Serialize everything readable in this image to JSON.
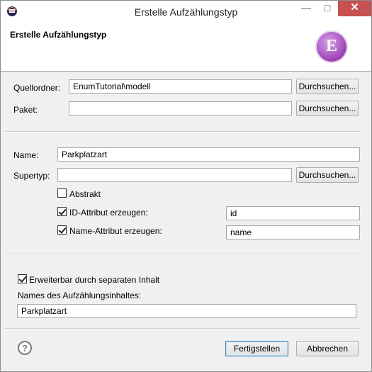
{
  "window": {
    "title": "Erstelle Aufzählungstyp"
  },
  "header": {
    "title": "Erstelle Aufzählungstyp",
    "icon": "enum-e-icon"
  },
  "source_folder": {
    "label": "Quellordner:",
    "value": "EnumTutorial\\modell",
    "button": "Durchsuchen..."
  },
  "package": {
    "label": "Paket:",
    "value": "",
    "button": "Durchsuchen..."
  },
  "name": {
    "label": "Name:",
    "value": "Parkplatzart"
  },
  "supertype": {
    "label": "Supertyp:",
    "value": "",
    "button": "Durchsuchen..."
  },
  "abstract": {
    "label": "Abstrakt",
    "checked": false
  },
  "id_attribute": {
    "label": "ID-Attribut erzeugen:",
    "checked": true,
    "value": "id"
  },
  "name_attribute": {
    "label": "Name-Attribut erzeugen:",
    "checked": true,
    "value": "name"
  },
  "extensible": {
    "label": "Erweiterbar durch separaten Inhalt",
    "checked": true
  },
  "content_name": {
    "label": "Names des Aufzählungsinhaltes:",
    "value": "Parkplatzart"
  },
  "footer": {
    "finish": "Fertigstellen",
    "cancel": "Abbrechen",
    "help": "?"
  }
}
